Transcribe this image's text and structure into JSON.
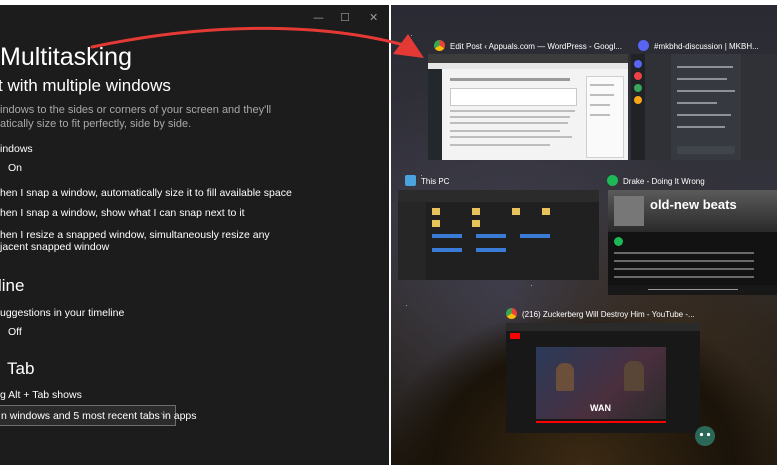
{
  "settings": {
    "window_controls": {
      "minimize": "—",
      "maximize": "☐",
      "close": "✕"
    },
    "title": "Multitasking",
    "snap": {
      "heading": "t with multiple windows",
      "description": [
        "indows to the sides or corners of your screen and they'll",
        "atically size to fit perfectly, side by side."
      ],
      "toggle_label": "indows",
      "toggle_state": "On",
      "options": [
        "hen I snap a window, automatically size it to fill available space",
        "hen I snap a window, show what I can snap next to it",
        "hen I resize a snapped window, simultaneously resize any",
        "jacent snapped window"
      ]
    },
    "timeline": {
      "heading": "line",
      "label": "uggestions in your timeline",
      "state": "Off"
    },
    "alt_tab": {
      "heading": "Tab",
      "label": "g Alt + Tab shows",
      "dropdown_value": "n windows and 5 most recent tabs in apps"
    }
  },
  "taskview": {
    "windows": [
      {
        "icon": "chrome-icon",
        "title": "Edit Post ‹ Appuals.com — WordPress - Googl..."
      },
      {
        "icon": "discord-icon",
        "title": "#mkbhd-discussion | MKBH..."
      },
      {
        "icon": "file-explorer-icon",
        "title": "This PC"
      },
      {
        "icon": "spotify-icon",
        "title": "Drake - Doing It Wrong"
      },
      {
        "icon": "chrome-icon",
        "title": "(216) Zuckerberg Will Destroy Him - YouTube -..."
      }
    ],
    "spotify_heading": "old-new beats",
    "youtube_badge": "WAN"
  },
  "colors": {
    "arrow": "#e53935",
    "panel": "#1c1c1c",
    "accent_green": "#1db954",
    "discord": "#5865f2"
  }
}
